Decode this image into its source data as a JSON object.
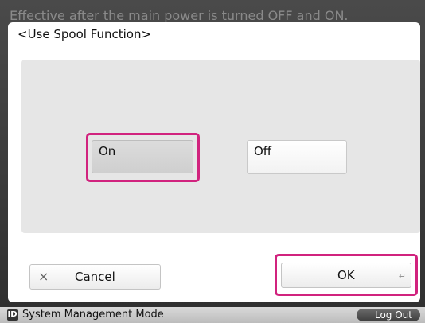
{
  "header": {
    "message": "Effective after the main power is turned OFF and ON."
  },
  "dialog": {
    "title": "<Use Spool Function>",
    "options": [
      {
        "label": "On",
        "selected": true
      },
      {
        "label": "Off",
        "selected": false
      }
    ],
    "cancel_label": "Cancel",
    "cancel_icon": "×",
    "ok_label": "OK",
    "ok_icon": "↵"
  },
  "status_bar": {
    "id_badge": "ID",
    "mode": "System Management Mode",
    "logout_label": "Log Out"
  },
  "colors": {
    "highlight": "#d1237e"
  }
}
